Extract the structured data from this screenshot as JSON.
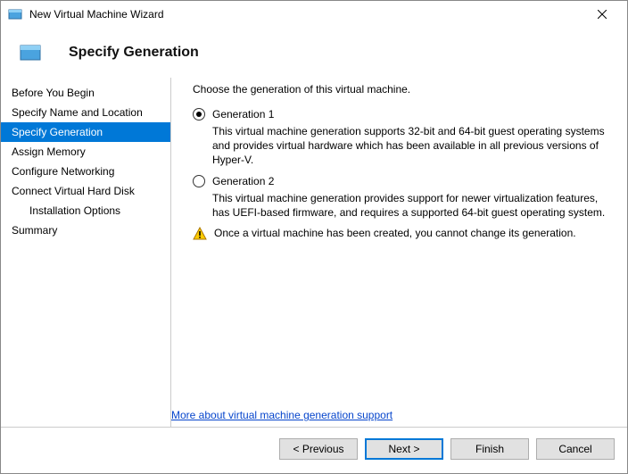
{
  "window": {
    "title": "New Virtual Machine Wizard"
  },
  "header": {
    "heading": "Specify Generation"
  },
  "sidebar": {
    "steps": [
      {
        "label": "Before You Begin"
      },
      {
        "label": "Specify Name and Location"
      },
      {
        "label": "Specify Generation"
      },
      {
        "label": "Assign Memory"
      },
      {
        "label": "Configure Networking"
      },
      {
        "label": "Connect Virtual Hard Disk"
      },
      {
        "label": "Installation Options"
      },
      {
        "label": "Summary"
      }
    ]
  },
  "main": {
    "instruction": "Choose the generation of this virtual machine.",
    "option1": {
      "label": "Generation 1",
      "description": "This virtual machine generation supports 32-bit and 64-bit guest operating systems and provides virtual hardware which has been available in all previous versions of Hyper-V."
    },
    "option2": {
      "label": "Generation 2",
      "description": "This virtual machine generation provides support for newer virtualization features, has UEFI-based firmware, and requires a supported 64-bit guest operating system."
    },
    "warning": "Once a virtual machine has been created, you cannot change its generation.",
    "link": "More about virtual machine generation support"
  },
  "footer": {
    "previous": "< Previous",
    "next": "Next >",
    "finish": "Finish",
    "cancel": "Cancel"
  }
}
